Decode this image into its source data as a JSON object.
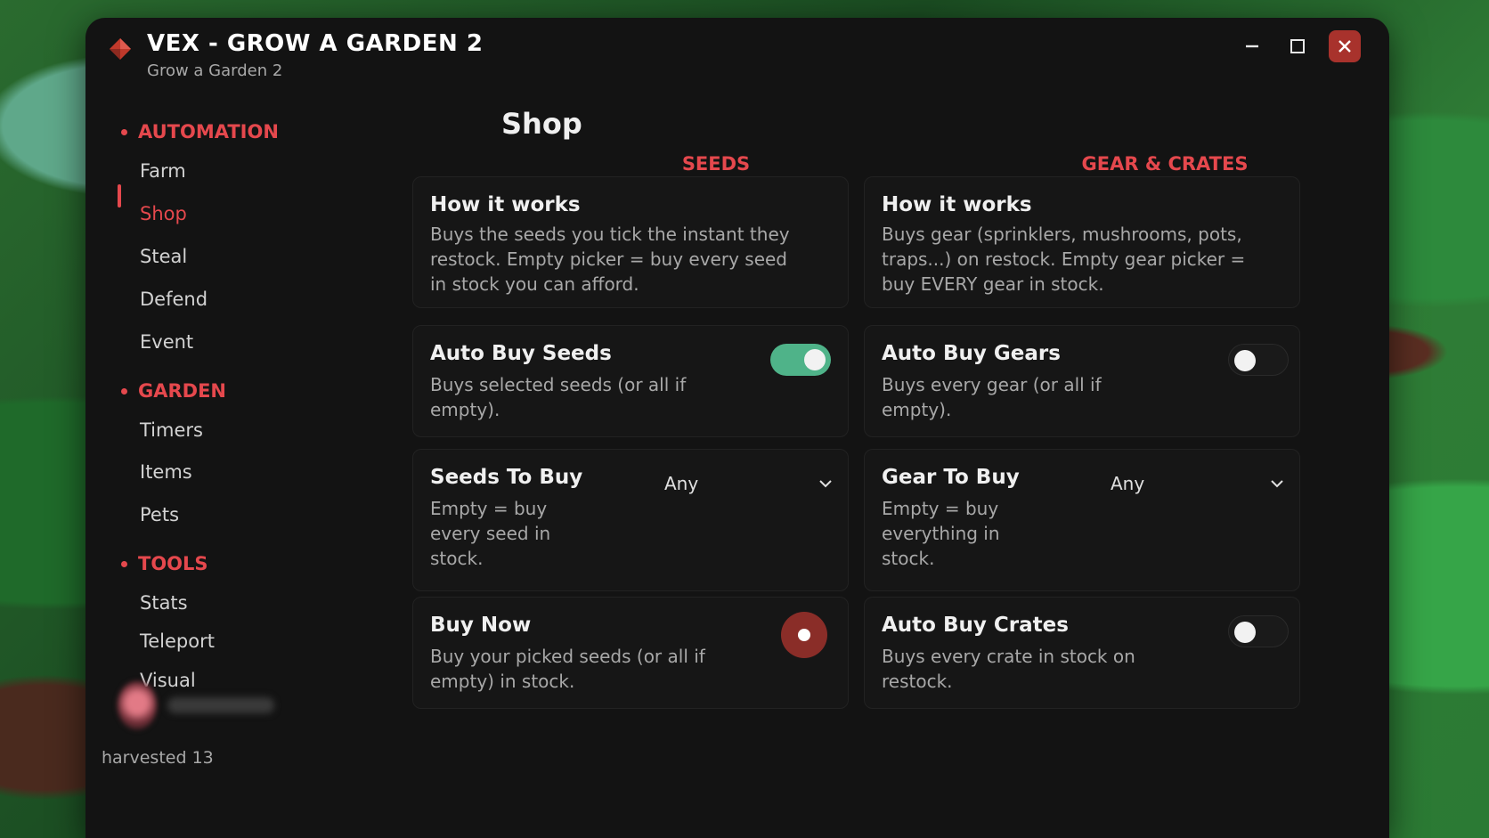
{
  "app": {
    "title": "VEX - GROW A GARDEN 2",
    "subtitle": "Grow a Garden 2"
  },
  "sidebar": {
    "sections": [
      {
        "label": "AUTOMATION",
        "items": [
          "Farm",
          "Shop",
          "Steal",
          "Defend",
          "Event"
        ]
      },
      {
        "label": "GARDEN",
        "items": [
          "Timers",
          "Items",
          "Pets"
        ]
      },
      {
        "label": "TOOLS",
        "items": [
          "Stats",
          "Teleport",
          "Visual"
        ]
      }
    ],
    "active_item": "Shop",
    "status": "harvested 13"
  },
  "page": {
    "title": "Shop",
    "columns": [
      {
        "heading": "SEEDS",
        "info": {
          "title": "How it works",
          "body": "Buys the seeds you tick the instant they restock. Empty picker = buy every seed in stock you can afford."
        },
        "toggle": {
          "title": "Auto Buy Seeds",
          "body": "Buys selected seeds (or all if empty).",
          "state": "on"
        },
        "picker": {
          "title": "Seeds To Buy",
          "body": "Empty = buy every seed in stock.",
          "value": "Any"
        },
        "action": {
          "title": "Buy Now",
          "body": "Buy your picked seeds (or all if empty) in stock."
        }
      },
      {
        "heading": "GEAR & CRATES",
        "info": {
          "title": "How it works",
          "body": "Buys gear (sprinklers, mushrooms, pots, traps...) on restock. Empty gear picker = buy EVERY gear in stock."
        },
        "toggle": {
          "title": "Auto Buy Gears",
          "body": "Buys every gear (or all if empty).",
          "state": "off"
        },
        "picker": {
          "title": "Gear To Buy",
          "body": "Empty = buy everything in stock.",
          "value": "Any"
        },
        "toggle2": {
          "title": "Auto Buy Crates",
          "body": "Buys every crate in stock on restock.",
          "state": "off"
        }
      }
    ]
  },
  "icons": {
    "logo": "gem-icon",
    "minimize": "minimize-icon",
    "maximize": "maximize-icon",
    "close": "close-icon",
    "dropdown": "chevron-down-icon"
  },
  "colors": {
    "accent": "#e5484d",
    "toggle_on": "#4fb389",
    "window_bg": "#131313",
    "card_bg": "#161616",
    "close_bg": "#a8322c",
    "buy_button": "#8a2d28"
  }
}
